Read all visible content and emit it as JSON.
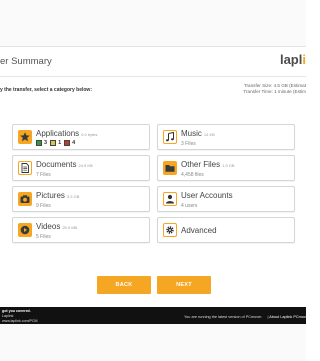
{
  "header": {
    "title": "er Summary",
    "logo_prefix": "lapl",
    "logo_accent": "i"
  },
  "instructions": "y the transfer, select a category below:",
  "transfer_info": {
    "size": "Transfer Size: 4.5 GB (Estimat",
    "time": "Transfer Time: 1 minute (Estim"
  },
  "categories": {
    "applications": {
      "label": "Applications",
      "size": "0.0 bytes",
      "counts": [
        "3",
        "1",
        "4"
      ],
      "count_colors": [
        "#2e9e3a",
        "#d9c34a",
        "#c0392b"
      ]
    },
    "music": {
      "label": "Music",
      "size": "14 KB",
      "sub": "3 Files"
    },
    "documents": {
      "label": "Documents",
      "size": "24.9 KB",
      "sub": "7 Files"
    },
    "other_files": {
      "label": "Other Files",
      "size": "1.9 GB",
      "sub": "4,458 files"
    },
    "pictures": {
      "label": "Pictures",
      "size": "3.3 GB",
      "sub": "9 Files"
    },
    "user_accounts": {
      "label": "User Accounts",
      "sub": "4 users"
    },
    "videos": {
      "label": "Videos",
      "size": "25.9 MB",
      "sub": "5 Files"
    },
    "advanced": {
      "label": "Advanced"
    }
  },
  "buttons": {
    "back": "BACK",
    "next": "NEXT"
  },
  "footer": {
    "line1": "got you covered.",
    "line2": "Laplink",
    "line3": "www.laplink.com/PCM",
    "status": "You are running the latest version of PCmover.",
    "about": "About Laplink PCmover"
  },
  "colors": {
    "accent": "#f5a623",
    "footer_bg": "#111111"
  }
}
